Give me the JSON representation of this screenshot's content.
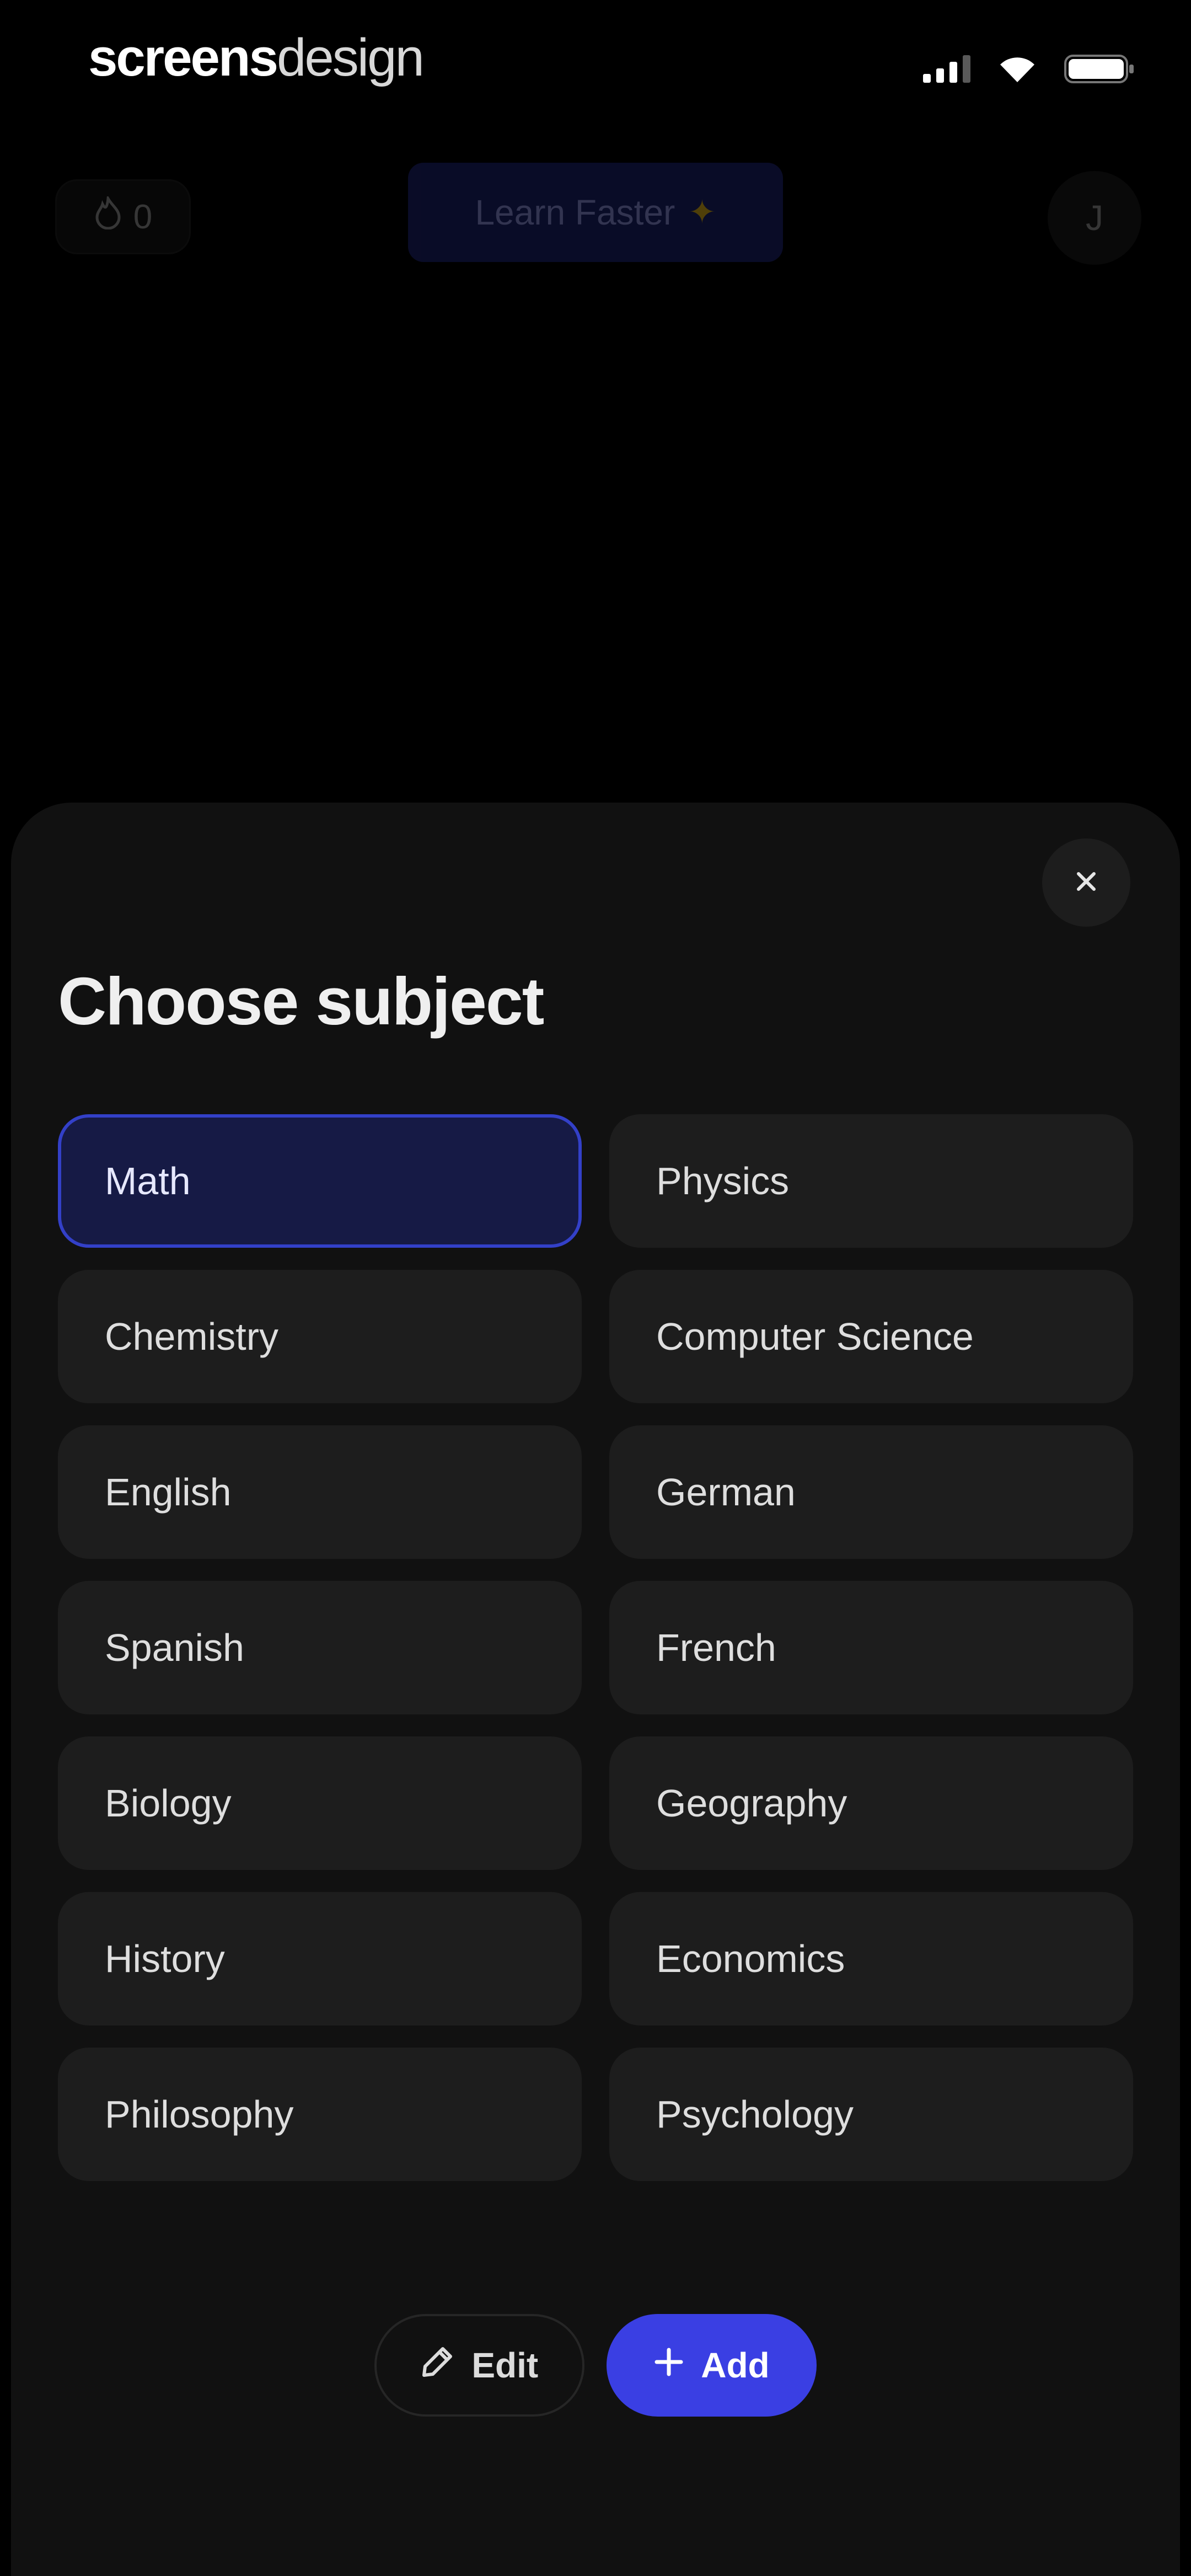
{
  "status_bar": {
    "brand_part1": "screens",
    "brand_part2": "design",
    "icons": [
      "cellular-signal-icon",
      "wifi-icon",
      "battery-icon"
    ]
  },
  "top_bar": {
    "streak_count": "0",
    "streak_icon": "flame-icon",
    "learn_faster_label": "Learn Faster",
    "learn_faster_icon": "sparkle-icon",
    "avatar_initial": "J"
  },
  "sheet": {
    "title": "Choose subject",
    "close_icon": "close-icon",
    "subjects": [
      {
        "label": "Math",
        "selected": true
      },
      {
        "label": "Physics",
        "selected": false
      },
      {
        "label": "Chemistry",
        "selected": false
      },
      {
        "label": "Computer Science",
        "selected": false
      },
      {
        "label": "English",
        "selected": false
      },
      {
        "label": "German",
        "selected": false
      },
      {
        "label": "Spanish",
        "selected": false
      },
      {
        "label": "French",
        "selected": false
      },
      {
        "label": "Biology",
        "selected": false
      },
      {
        "label": "Geography",
        "selected": false
      },
      {
        "label": "History",
        "selected": false
      },
      {
        "label": "Economics",
        "selected": false
      },
      {
        "label": "Philosophy",
        "selected": false
      },
      {
        "label": "Psychology",
        "selected": false
      }
    ],
    "edit_label": "Edit",
    "edit_icon": "pencil-icon",
    "add_label": "Add",
    "add_icon": "plus-icon"
  },
  "colors": {
    "background": "#000000",
    "sheet": "#111111",
    "option": "#1d1d1d",
    "selected_fill": "#161a45",
    "selected_border": "#3340c8",
    "accent": "#3a3fe3"
  }
}
